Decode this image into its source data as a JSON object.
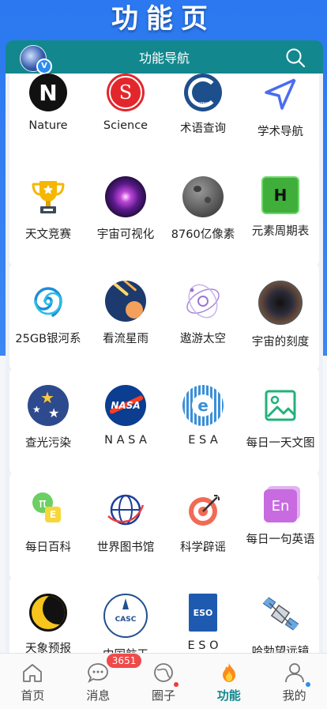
{
  "page_heading": "功能页",
  "navbar": {
    "title": "功能导航"
  },
  "rows": [
    {
      "items": [
        {
          "label": "Nature",
          "icon": "nature-logo-icon"
        },
        {
          "label": "Science",
          "icon": "science-logo-icon"
        },
        {
          "label": "术语查询",
          "icon": "cnterm-logo-icon"
        },
        {
          "label": "学术导航",
          "icon": "send-arrow-icon"
        }
      ]
    },
    {
      "items": [
        {
          "label": "天文竞赛",
          "icon": "trophy-icon"
        },
        {
          "label": "宇宙可视化",
          "icon": "galaxy-icon"
        },
        {
          "label": "8760亿像素",
          "icon": "moon-icon"
        },
        {
          "label": "元素周期表",
          "icon": "hydrogen-element-icon"
        }
      ]
    },
    {
      "items": [
        {
          "label": "25GB银河系",
          "icon": "spiral-galaxy-icon"
        },
        {
          "label": "看流星雨",
          "icon": "meteor-shower-icon"
        },
        {
          "label": "遨游太空",
          "icon": "orbit-icon"
        },
        {
          "label": "宇宙的刻度",
          "icon": "cosmic-scale-icon"
        }
      ]
    },
    {
      "items": [
        {
          "label": "查光污染",
          "icon": "stars-icon"
        },
        {
          "label": "N A S A",
          "icon": "nasa-logo-icon"
        },
        {
          "label": "E S A",
          "icon": "esa-logo-icon"
        },
        {
          "label": "每日一天文图",
          "icon": "image-icon"
        }
      ]
    },
    {
      "items": [
        {
          "label": "每日百科",
          "icon": "pi-encyclopedia-icon"
        },
        {
          "label": "世界图书馆",
          "icon": "globe-icon"
        },
        {
          "label": "科学辟谣",
          "icon": "target-icon"
        },
        {
          "label": "每日一句英语",
          "icon": "english-icon"
        }
      ]
    },
    {
      "items": [
        {
          "label": "天象预报",
          "icon": "crescent-moon-icon"
        },
        {
          "label": "中国航天",
          "icon": "casc-logo-icon"
        },
        {
          "label": "E S O",
          "icon": "eso-logo-icon"
        },
        {
          "label": "哈勃望远镜",
          "icon": "satellite-icon"
        }
      ]
    }
  ],
  "icon_text": {
    "nature": "N",
    "science": "S",
    "hydrogen": "H",
    "nasa": "NASA",
    "esa": "e",
    "pi": "π",
    "pi_sub": "E",
    "english": "En",
    "casc": "CASC",
    "eso": "ESO",
    "cnterm": "CNTERM"
  },
  "tabbar": {
    "tabs": [
      {
        "label": "首页",
        "icon": "home-icon"
      },
      {
        "label": "消息",
        "icon": "chat-icon",
        "badge": "3651"
      },
      {
        "label": "圈子",
        "icon": "planet-icon"
      },
      {
        "label": "功能",
        "icon": "flame-icon"
      },
      {
        "label": "我的",
        "icon": "person-icon"
      }
    ],
    "active_index": 3
  },
  "colors": {
    "accent": "#12888e",
    "header_blue": "#2b78f0",
    "badge_red": "#ef4a4a"
  }
}
